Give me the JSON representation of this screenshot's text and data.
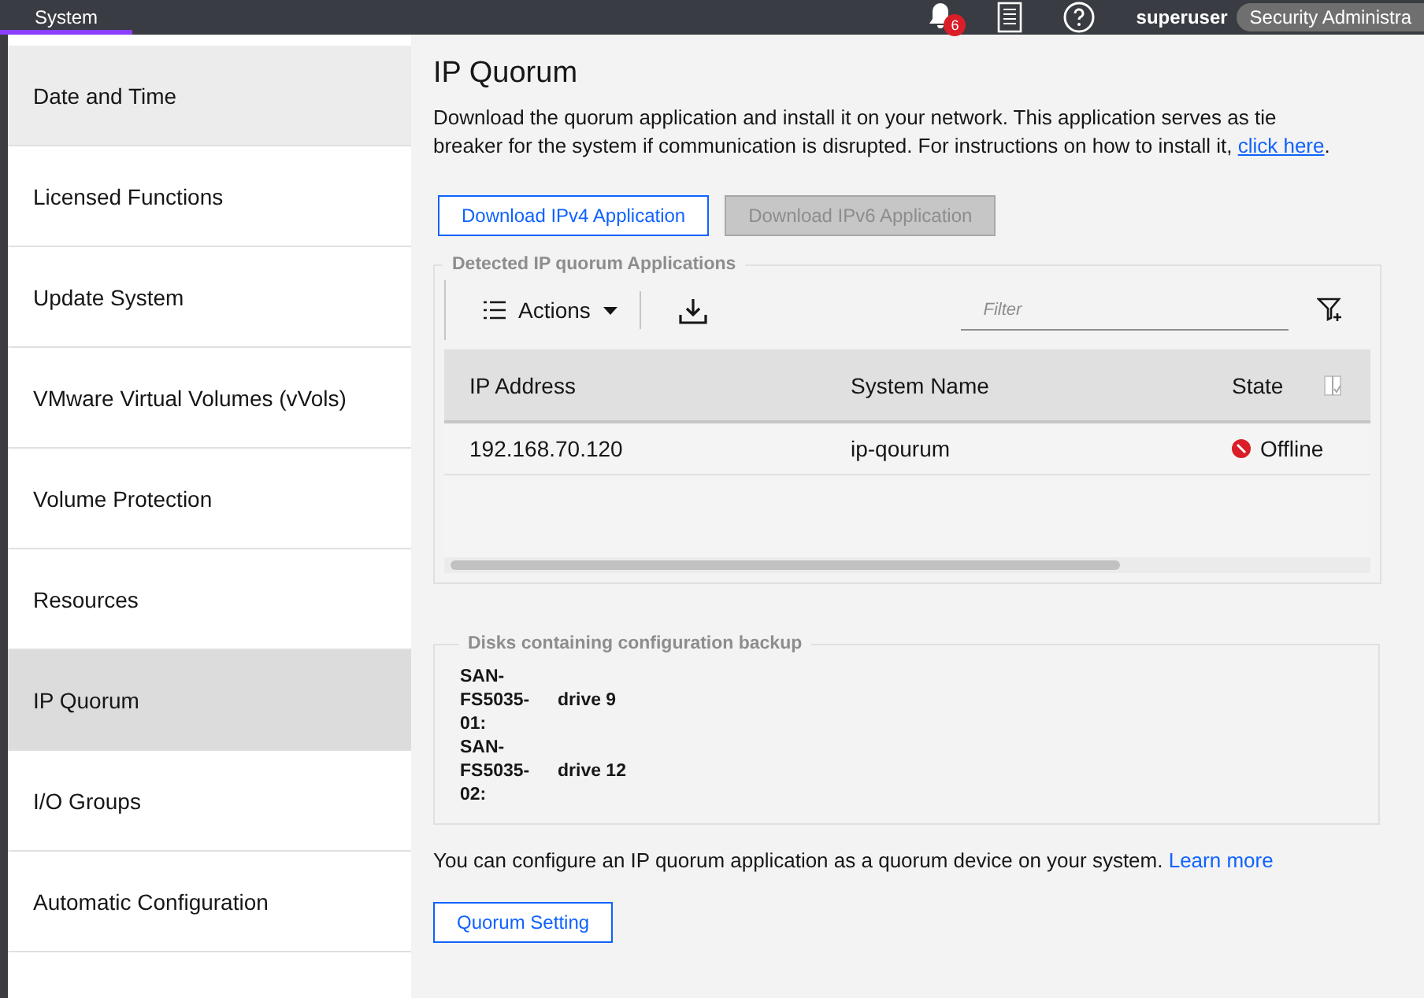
{
  "topbar": {
    "tab": {
      "label": "System",
      "selected": true
    },
    "notifications": {
      "count": "6"
    },
    "user": "superuser",
    "role": "Security Administra"
  },
  "sidebar": {
    "items": [
      {
        "label": "Date and Time",
        "selected": false,
        "hovered": true
      },
      {
        "label": "Licensed Functions",
        "selected": false,
        "hovered": false
      },
      {
        "label": "Update System",
        "selected": false,
        "hovered": false
      },
      {
        "label": "VMware Virtual Volumes (vVols)",
        "selected": false,
        "hovered": false
      },
      {
        "label": "Volume Protection",
        "selected": false,
        "hovered": false
      },
      {
        "label": "Resources",
        "selected": false,
        "hovered": false
      },
      {
        "label": "IP Quorum",
        "selected": true,
        "hovered": false
      },
      {
        "label": "I/O Groups",
        "selected": false,
        "hovered": false
      },
      {
        "label": "Automatic Configuration",
        "selected": false,
        "hovered": false
      }
    ]
  },
  "content": {
    "title": "IP Quorum",
    "description": "Download the quorum application and install it on your network. This application serves as tie breaker for the system if communication is disrupted. For instructions on how to install it, ",
    "description_link": "click here",
    "description_end": ".",
    "buttons": [
      {
        "label": "Download IPv4 Application",
        "disabled": false
      },
      {
        "label": "Download IPv6 Application",
        "disabled": true
      }
    ],
    "detected": {
      "legend": "Detected IP quorum Applications",
      "actions": "Actions",
      "filter": {
        "placeholder": "Filter"
      },
      "table": {
        "columns": [
          "IP Address",
          "System Name",
          "State"
        ],
        "rows": [
          {
            "ip": "192.168.70.120",
            "system_name": "ip-qourum",
            "state": "Offline",
            "color": "#da1e28"
          }
        ]
      }
    },
    "disks": {
      "legend": "Disks containing configuration backup",
      "items": [
        {
          "name": "SAN-FS5035-01:",
          "drive": "drive 9"
        },
        {
          "name": "SAN-FS5035-02:",
          "drive": "drive 12"
        }
      ]
    },
    "note": "You can configure an IP quorum application as a quorum device on your system. ",
    "note_link": "Learn more",
    "setting_button": "Quorum Setting"
  }
}
